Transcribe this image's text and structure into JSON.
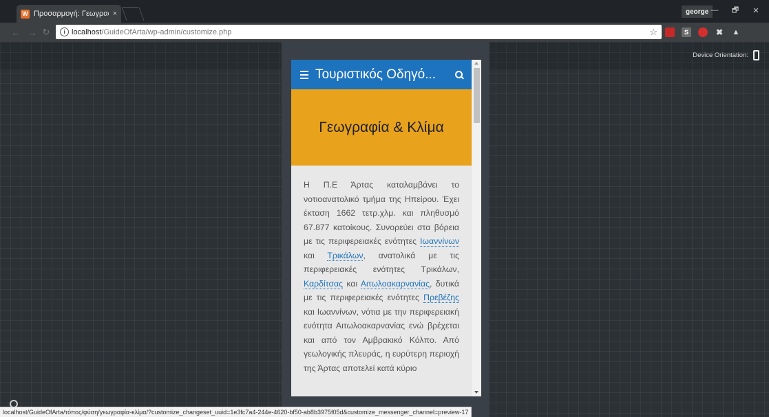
{
  "browser": {
    "tab_title": "Προσαρμογή: Γεωγραφί",
    "tab_close": "×",
    "profile_name": "george",
    "window_buttons": [
      "—",
      "🗗",
      "✕"
    ],
    "url_host": "localhost",
    "url_path": "/GuideOfArta/wp-admin/customize.php",
    "info_glyph": "i",
    "star_glyph": "☆",
    "status_url": "localhost/GuideOfArta/τόπος/φύση/γεωγραφία-κλίμα/?customize_changeset_uuid=1e3fc7a4-244e-4620-bf50-ab8b3975f05d&customize_messenger_channel=preview-17"
  },
  "customizer": {
    "orientation_label": "Device Orientation:"
  },
  "site": {
    "title": "Τουριστικός Οδηγό...",
    "page_heading": "Γεωγραφία & Κλίμα",
    "paragraph": {
      "t1": "Η Π.Ε Άρτας καταλαμβάνει το νοτιοανατολικό τμήμα της Ηπείρου. Έχει έκταση 1662 τετρ.χλμ. και πληθυσμό 67.877 κατοίκους. Συνορεύει στα βόρεια με τις περιφερειακές ενότητες ",
      "link1": "Ιωαννίνων",
      "t2": " και ",
      "link2": "Τρικάλων",
      "t3": ", ανατολικά με τις περιφερειακές ενότητες Τρικάλων, ",
      "link3": "Καρδίτσας",
      "t4": " και ",
      "link4": "Αιτωλοακαρνανίας",
      "t5": ", δυτικά με τις περιφερειακές ενότητες ",
      "link5": "Πρεβέζης",
      "t6": " και Ιωαννίνων, νότια με την περιφερειακή ενότητα Αιτωλοακαρνανίας ενώ βρέχεται και από τον Αμβρακικό Κόλπο. Από γεωλογικής πλευράς, η ευρύτερη περιοχή της Άρτας αποτελεί κατά κύριο"
    }
  },
  "colors": {
    "header": "#1e73be",
    "hero": "#e8a21c",
    "link": "#1e73be"
  }
}
